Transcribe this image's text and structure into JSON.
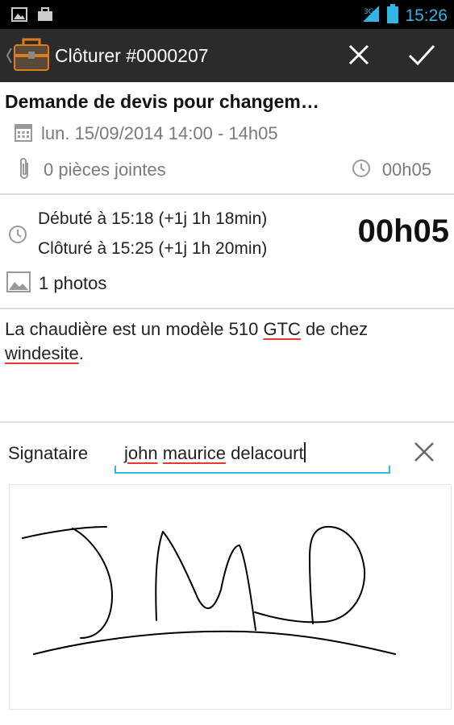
{
  "status_bar": {
    "time": "15:26"
  },
  "action_bar": {
    "title": "Clôturer #0000207"
  },
  "ticket": {
    "title": "Demande de devis pour changem…",
    "datetime": "lun. 15/09/2014 14:00 - 14h05",
    "attachments": "0 pièces jointes",
    "duration": "00h05"
  },
  "intervention": {
    "started": "Débuté à 15:18 (+1j 1h 18min)",
    "closed": "Clôturé à 15:25 (+1j 1h 20min)",
    "duration": "00h05",
    "photos": "1 photos"
  },
  "note": {
    "part1": "La chaudière est un modèle 510 ",
    "word1": "GTC",
    "part2": " de chez ",
    "word2": "windesite",
    "part3": "."
  },
  "signature": {
    "label": "Signataire",
    "value_word1": "john",
    "value_word2": "maurice",
    "value_rest": "delacourt"
  },
  "colors": {
    "accent": "#33b5e5",
    "spellcheck": "#e53935",
    "action_bar": "#2b2b2b"
  }
}
